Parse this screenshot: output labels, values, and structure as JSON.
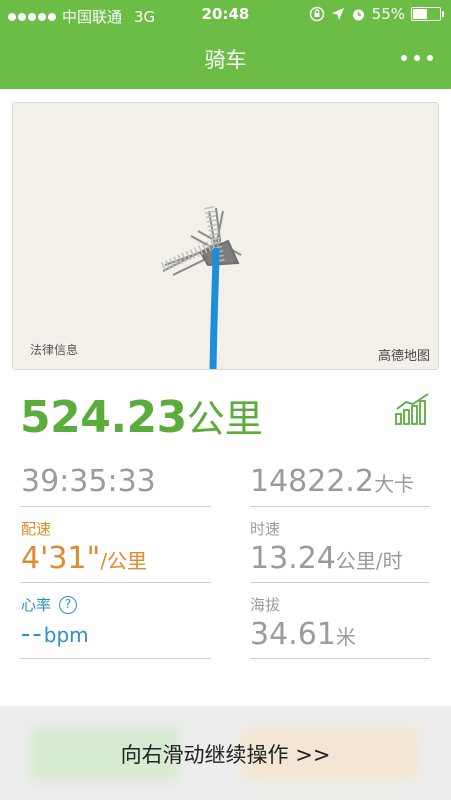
{
  "status": {
    "carrier": "中国联通",
    "network": "3G",
    "time": "20:48",
    "battery_text": "55%",
    "battery_level": 0.55
  },
  "nav": {
    "title": "骑车",
    "more_icon": "more-dots-icon"
  },
  "map": {
    "legal_text": "法律信息",
    "brand_text": "高德地图"
  },
  "summary": {
    "distance_value": "524.23",
    "distance_unit": "公里",
    "chart_icon": "bar-chart-icon"
  },
  "stats": {
    "duration": "39:35:33",
    "calories_value": "14822.2",
    "calories_unit": "大卡",
    "pace_label": "配速",
    "pace_value": "4'31\"",
    "pace_unit": "/公里",
    "speed_label": "时速",
    "speed_value": "13.24",
    "speed_unit": "公里/时",
    "hr_label": "心率",
    "hr_help": "?",
    "hr_value": "--",
    "hr_unit": "bpm",
    "alt_label": "海拔",
    "alt_value": "34.61",
    "alt_unit": "米"
  },
  "swipe": {
    "text": "向右滑动继续操作 >>"
  },
  "colors": {
    "brand_green": "#6cbd45",
    "distance_green": "#5aad3c",
    "pace_orange": "#e08a2e",
    "hr_blue": "#2b90c9",
    "route_blue": "#1d8fd8"
  }
}
